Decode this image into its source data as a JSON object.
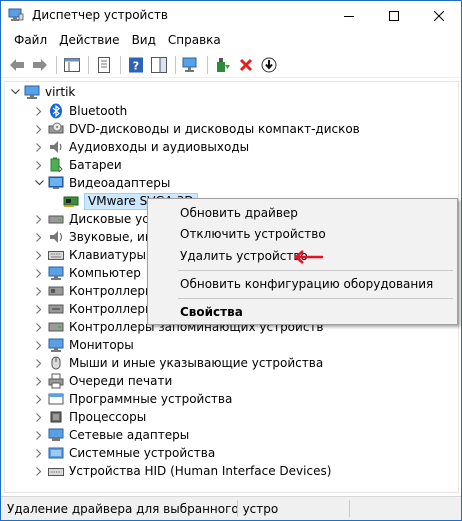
{
  "window": {
    "title": "Диспетчер устройств"
  },
  "menu": [
    "Файл",
    "Действие",
    "Вид",
    "Справка"
  ],
  "tree": {
    "root": "virtik",
    "items": [
      {
        "label": "Bluetooth",
        "icon": "bluetooth-icon",
        "expanded": false
      },
      {
        "label": "DVD-дисководы и дисководы компакт-дисков",
        "icon": "dvd-drive-icon",
        "expanded": false
      },
      {
        "label": "Аудиовходы и аудиовыходы",
        "icon": "audio-io-icon",
        "expanded": false
      },
      {
        "label": "Батареи",
        "icon": "battery-icon",
        "expanded": false
      },
      {
        "label": "Видеоадаптеры",
        "icon": "display-adapter-icon",
        "expanded": true
      },
      {
        "label": "VMware SVGA 3D",
        "icon": "display-adapter-icon",
        "child": true,
        "selected": true
      },
      {
        "label": "Дисковые устройства",
        "icon": "disk-drive-icon",
        "expanded": false
      },
      {
        "label": "Звуковые, игровые и видеоустройства",
        "icon": "sound-icon",
        "expanded": false
      },
      {
        "label": "Клавиатуры",
        "icon": "keyboard-icon",
        "expanded": false
      },
      {
        "label": "Компьютер",
        "icon": "computer-icon",
        "expanded": false
      },
      {
        "label": "Контроллеры IDE ATA/ATAPI",
        "icon": "controller-icon",
        "expanded": false
      },
      {
        "label": "Контроллеры USB",
        "icon": "usb-controller-icon",
        "expanded": false
      },
      {
        "label": "Контроллеры запоминающих устройств",
        "icon": "storage-controller-icon",
        "expanded": false
      },
      {
        "label": "Мониторы",
        "icon": "monitor-icon",
        "expanded": false
      },
      {
        "label": "Мыши и иные указывающие устройства",
        "icon": "mouse-icon",
        "expanded": false
      },
      {
        "label": "Очереди печати",
        "icon": "printer-icon",
        "expanded": false
      },
      {
        "label": "Программные устройства",
        "icon": "software-device-icon",
        "expanded": false
      },
      {
        "label": "Процессоры",
        "icon": "processor-icon",
        "expanded": false
      },
      {
        "label": "Сетевые адаптеры",
        "icon": "network-adapter-icon",
        "expanded": false
      },
      {
        "label": "Системные устройства",
        "icon": "system-device-icon",
        "expanded": false
      },
      {
        "label": "Устройства HID (Human Interface Devices)",
        "icon": "hid-icon",
        "expanded": false
      }
    ]
  },
  "context_menu": {
    "update_driver": "Обновить драйвер",
    "disable_device": "Отключить устройство",
    "uninstall_device": "Удалить устройство",
    "scan_hardware": "Обновить конфигурацию оборудования",
    "properties": "Свойства"
  },
  "status_bar": {
    "text": "Удаление драйвера для выбранного устро"
  },
  "colors": {
    "accent": "#0078d7",
    "arrow": "#e81123",
    "selection": "#cce8ff"
  }
}
